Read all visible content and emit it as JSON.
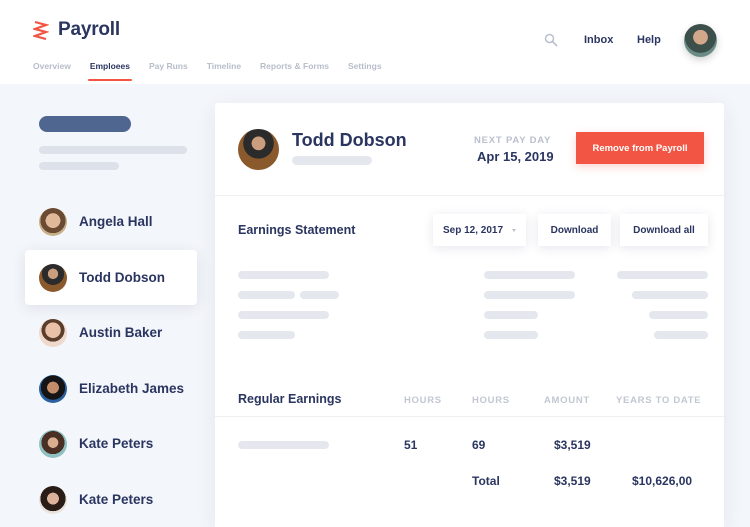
{
  "app": {
    "title": "Payroll",
    "logo_icon": "zigzag-logo-icon",
    "brand_color": "#f25543"
  },
  "nav": {
    "tabs": [
      {
        "label": "Overview",
        "active": false
      },
      {
        "label": "Emploees",
        "active": true
      },
      {
        "label": "Pay Runs",
        "active": false
      },
      {
        "label": "Timeline",
        "active": false
      },
      {
        "label": "Reports & Forms",
        "active": false
      },
      {
        "label": "Settings",
        "active": false
      }
    ]
  },
  "header": {
    "search_icon": "search-icon",
    "inbox_label": "Inbox",
    "help_label": "Help"
  },
  "employees": [
    {
      "name": "Angela Hall",
      "active": false
    },
    {
      "name": "Todd Dobson",
      "active": true
    },
    {
      "name": "Austin Baker",
      "active": false
    },
    {
      "name": "Elizabeth James",
      "active": false
    },
    {
      "name": "Kate Peters",
      "active": false
    },
    {
      "name": "Kate Peters",
      "active": false
    }
  ],
  "detail": {
    "name": "Todd Dobson",
    "next_pay_day_label": "NEXT PAY DAY",
    "next_pay_day": "Apr 15, 2019",
    "remove_label": "Remove from Payroll"
  },
  "earnings_statement": {
    "title": "Earnings Statement",
    "selected_date": "Sep 12, 2017",
    "download_label": "Download",
    "download_all_label": "Download all"
  },
  "regular_earnings": {
    "title": "Regular Earnings",
    "columns": [
      "HOURS",
      "HOURS",
      "AMOUNT",
      "YEARS TO DATE"
    ],
    "row": {
      "hours1": "51",
      "hours2": "69",
      "amount": "$3,519"
    },
    "total": {
      "label": "Total",
      "amount": "$3,519",
      "ytd": "$10,626,00"
    }
  }
}
